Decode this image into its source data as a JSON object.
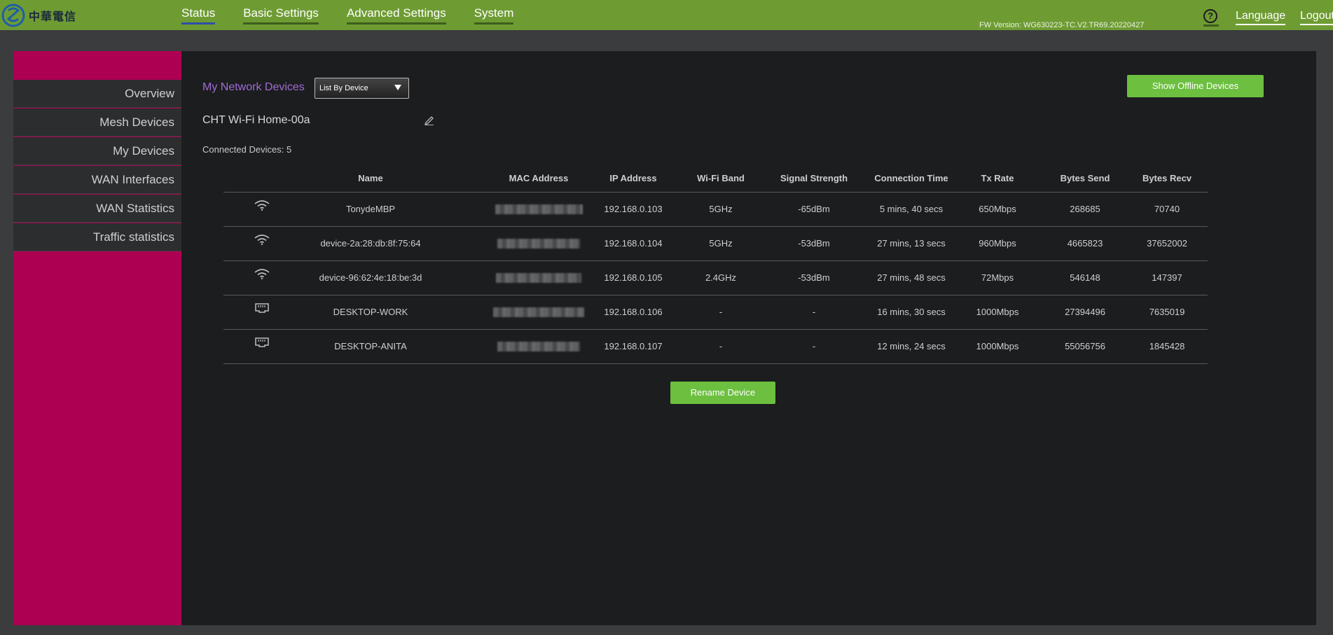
{
  "brand": {
    "name": "中華電信"
  },
  "topnav": {
    "items": [
      {
        "label": "Status",
        "active": true
      },
      {
        "label": "Basic Settings",
        "active": false
      },
      {
        "label": "Advanced Settings",
        "active": false
      },
      {
        "label": "System",
        "active": false
      }
    ],
    "fw_version": "FW Version: WG630223-TC.V2.TR69.20220427",
    "help_glyph": "?",
    "language_label": "Language",
    "logout_label": "Logout"
  },
  "sidebar": {
    "items": [
      {
        "label": "Overview"
      },
      {
        "label": "Mesh Devices"
      },
      {
        "label": "My Devices"
      },
      {
        "label": "WAN Interfaces"
      },
      {
        "label": "WAN Statistics"
      },
      {
        "label": "Traffic statistics"
      }
    ]
  },
  "main": {
    "title": "My Network Devices",
    "view_select": {
      "selected": "List By Device"
    },
    "show_offline_label": "Show Offline Devices",
    "ssid": "CHT Wi-Fi Home-00a",
    "connected_devices": "Connected Devices: 5",
    "columns": [
      "Name",
      "MAC Address",
      "IP Address",
      "Wi-Fi Band",
      "Signal Strength",
      "Connection Time",
      "Tx Rate",
      "Bytes Send",
      "Bytes Recv"
    ],
    "rows": [
      {
        "icon": "wifi-icon",
        "name": "TonydeMBP",
        "ip": "192.168.0.103",
        "band": "5GHz",
        "signal": "-65dBm",
        "time": "5 mins, 40 secs",
        "tx": "650Mbps",
        "sent": "268685",
        "recv": "70740"
      },
      {
        "icon": "wifi-icon",
        "name": "device-2a:28:db:8f:75:64",
        "ip": "192.168.0.104",
        "band": "5GHz",
        "signal": "-53dBm",
        "time": "27 mins, 13 secs",
        "tx": "960Mbps",
        "sent": "4665823",
        "recv": "37652002"
      },
      {
        "icon": "wifi-icon",
        "name": "device-96:62:4e:18:be:3d",
        "ip": "192.168.0.105",
        "band": "2.4GHz",
        "signal": "-53dBm",
        "time": "27 mins, 48 secs",
        "tx": "72Mbps",
        "sent": "546148",
        "recv": "147397"
      },
      {
        "icon": "ethernet-icon",
        "name": "DESKTOP-WORK",
        "ip": "192.168.0.106",
        "band": "-",
        "signal": "-",
        "time": "16 mins, 30 secs",
        "tx": "1000Mbps",
        "sent": "27394496",
        "recv": "7635019"
      },
      {
        "icon": "ethernet-icon",
        "name": "DESKTOP-ANITA",
        "ip": "192.168.0.107",
        "band": "-",
        "signal": "-",
        "time": "12 mins, 24 secs",
        "tx": "1000Mbps",
        "sent": "55056756",
        "recv": "1845428"
      }
    ],
    "rename_label": "Rename Device"
  },
  "colors": {
    "topbar": "#6e9c33",
    "sidebar_accent": "#ad0052",
    "button_green": "#6cbf3f",
    "title_purple": "#a06cd5"
  }
}
